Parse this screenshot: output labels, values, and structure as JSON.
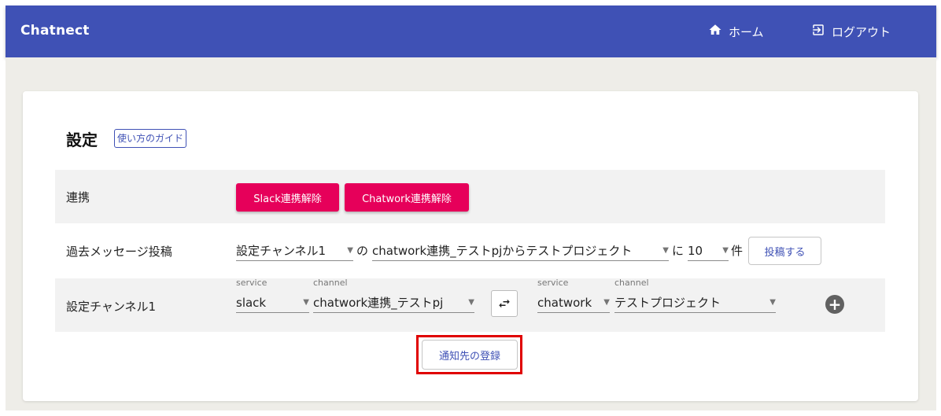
{
  "appbar": {
    "brand": "Chatnect",
    "home_label": "ホーム",
    "logout_label": "ログアウト",
    "color": "#3f51b5"
  },
  "settings": {
    "title": "設定",
    "guide_label": "使い方のガイド"
  },
  "integration": {
    "label": "連携",
    "slack_disconnect": "Slack連携解除",
    "chatwork_disconnect": "Chatwork連携解除",
    "button_color": "#e6005a"
  },
  "past_messages": {
    "label": "過去メッセージ投稿",
    "channel_select": "設定チャンネル1",
    "connector_no": "の",
    "pair_select": "chatwork連携_テストpjからテストプロジェクト",
    "connector_ni": "に",
    "count_select": "10",
    "unit": "件",
    "post_button": "投稿する"
  },
  "channel_setting": {
    "label": "設定チャンネル1",
    "left": {
      "service_caption": "service",
      "service_value": "slack",
      "channel_caption": "channel",
      "channel_value": "chatwork連携_テストpj"
    },
    "right": {
      "service_caption": "service",
      "service_value": "chatwork",
      "channel_caption": "channel",
      "channel_value": "テストプロジェクト"
    },
    "add_symbol": "+"
  },
  "register_button": "通知先の登録",
  "icons": {
    "home": "home-icon",
    "logout": "logout-icon",
    "swap": "swap-horizontal-icon",
    "add": "add-circle-icon",
    "dropdown": "chevron-down-icon"
  }
}
